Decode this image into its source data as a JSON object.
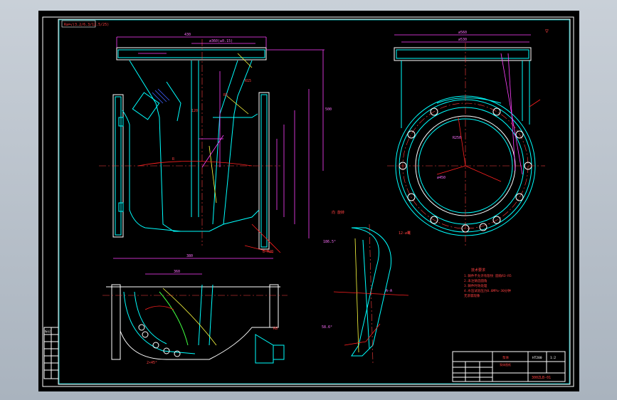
{
  "drawing": {
    "roughness_note": "Ra=√(3.2/6.3/12.5/25)",
    "section_label": "A-A",
    "rotation_label": "向 旋转",
    "main_dims": {
      "overall_width": "430",
      "bore_width": "∅360(±0.15)",
      "height": "500",
      "side_width": "380",
      "top_dia": "∅560",
      "top_inner": "∅530",
      "bore_dia": "∅450",
      "radius": "R250",
      "flange_bolts": "12-∅鼍",
      "angle_1": "186.5°",
      "angle_2": "58.6°"
    },
    "tech_requirements": {
      "title": "技术要求",
      "lines": [
        "1.铸件不允许有裂纹 圆角R3-R5",
        "2.未注铸造圆角",
        "3.铸件时效处理",
        "4.水压试验压力0.6MPa-30分钟",
        "  无渗漏现象"
      ]
    },
    "title_block": {
      "part_name": "泵体",
      "material": "HT200",
      "scale": "1:2",
      "drawing_no": "300ZLB-01",
      "company": "泵体图纸"
    },
    "corner_mark": "▽"
  },
  "side_table": {
    "header": "标记",
    "rows": [
      "",
      "",
      "",
      "",
      "",
      ""
    ]
  },
  "colors": {
    "background": "#000000",
    "frame": "#ffffff",
    "outline": "#00ffff",
    "dimension": "#ff40ff",
    "centerline": "#ff4040"
  }
}
